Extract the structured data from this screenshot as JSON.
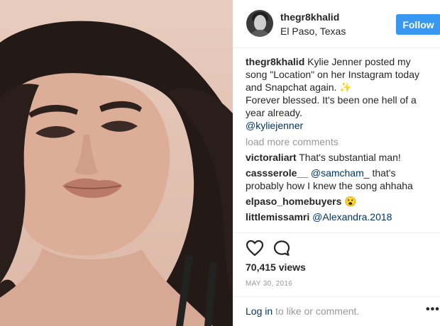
{
  "post": {
    "author": "thegr8khalid",
    "location": "El Paso, Texas",
    "follow_label": "Follow",
    "caption": {
      "username": "thegr8khalid",
      "text_1": "Kylie Jenner posted my song \"Location\" on her Instagram today and Snapchat again.",
      "sparkle": "✨",
      "text_2": "Forever blessed. It's been one hell of a year already.",
      "mention": "@kyliejenner"
    },
    "load_more": "load more comments",
    "comments": [
      {
        "username": "victoraliart",
        "text": "That's substantial man!"
      },
      {
        "username": "cassserole__",
        "mention": "@samcham_",
        "text": "that's probably how I knew the song ahhaha"
      },
      {
        "username": "elpaso_homebuyers",
        "emoji": "😮"
      },
      {
        "username": "littlemissamri",
        "mention": "@Alexandra.2018"
      }
    ],
    "views": "70,415 views",
    "date": "MAY 30, 2016",
    "login_link": "Log in",
    "login_text": "to like or comment.",
    "more_label": "•••",
    "icons": [
      "heart-icon",
      "comment-icon",
      "more-options-icon"
    ],
    "colors": {
      "follow": "#3897f0",
      "link": "#003569",
      "muted": "#999999"
    }
  }
}
